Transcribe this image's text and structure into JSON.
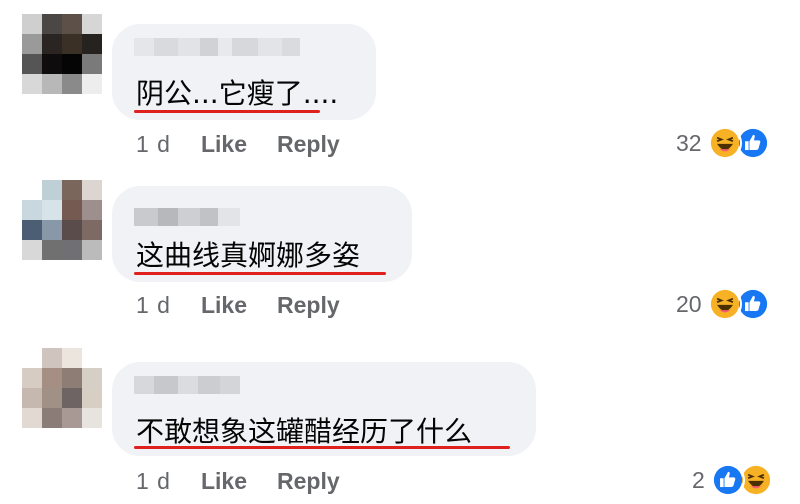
{
  "comments": [
    {
      "text": "阴公...它瘦了....",
      "time": "1 d",
      "like_label": "Like",
      "reply_label": "Reply",
      "reaction_count": "32",
      "reactions": [
        "haha-icon",
        "like-icon"
      ]
    },
    {
      "text": "这曲线真婀娜多姿",
      "time": "1 d",
      "like_label": "Like",
      "reply_label": "Reply",
      "reaction_count": "20",
      "reactions": [
        "haha-icon",
        "like-icon"
      ]
    },
    {
      "text": "不敢想象这罐醋经历了什么",
      "time": "1 d",
      "like_label": "Like",
      "reply_label": "Reply",
      "reaction_count": "2",
      "reactions": [
        "like-icon",
        "haha-icon"
      ]
    }
  ],
  "colors": {
    "bubble": "#f0f2f5",
    "underline": "#e0201c",
    "secondary_text": "#65676b",
    "like_blue": "#1877f2",
    "haha_yellow": "#f7b125"
  }
}
